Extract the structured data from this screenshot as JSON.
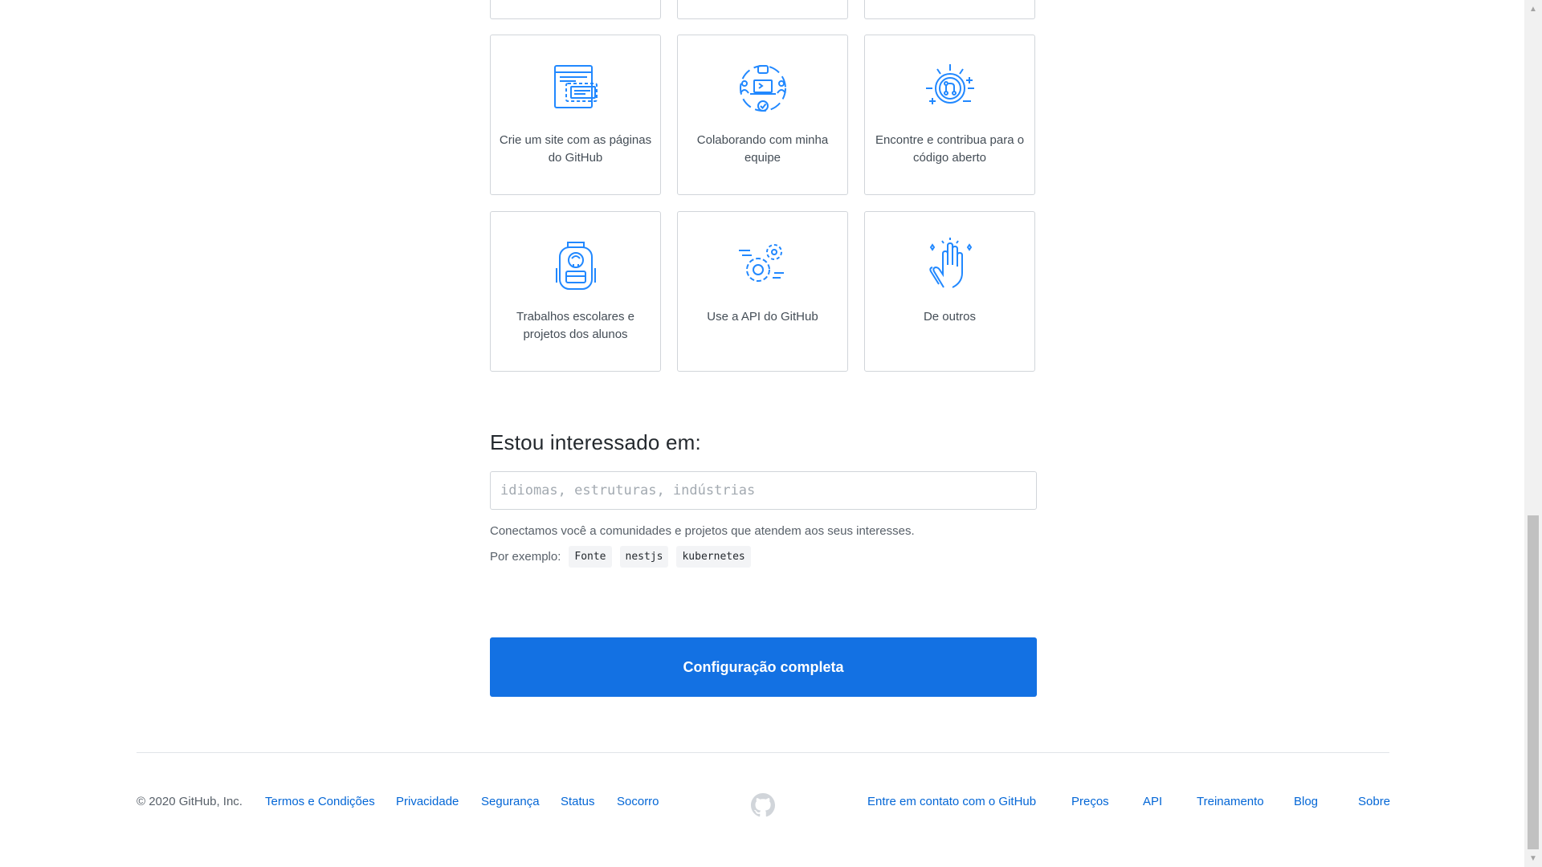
{
  "cards": {
    "row2": [
      {
        "label": "Crie um site com as páginas do GitHub",
        "icon": "web-pages-icon"
      },
      {
        "label": "Colaborando com minha equipe",
        "icon": "team-collab-icon"
      },
      {
        "label": "Encontre e contribua para o código aberto",
        "icon": "open-source-icon"
      }
    ],
    "row3": [
      {
        "label": "Trabalhos escolares e projetos dos alunos",
        "icon": "backpack-icon"
      },
      {
        "label": "Use a API do GitHub",
        "icon": "gear-api-icon"
      },
      {
        "label": "De outros",
        "icon": "high-five-icon"
      }
    ]
  },
  "interest": {
    "heading": "Estou interessado em:",
    "placeholder": "idiomas, estruturas, indústrias",
    "help": "Conectamos você a comunidades e projetos que atendem aos seus interesses.",
    "examples_label": "Por exemplo:",
    "examples": [
      "Fonte",
      "nestjs",
      "kubernetes"
    ]
  },
  "complete_button": "Configuração completa",
  "footer": {
    "copyright": "© 2020 GitHub, Inc.",
    "left_links": [
      "Termos e Condições",
      "Privacidade",
      "Segurança",
      "Status",
      "Socorro"
    ],
    "right_links": [
      "Entre em contato com o GitHub",
      "Preços",
      "API",
      "Treinamento",
      "Blog",
      "Sobre"
    ]
  },
  "colors": {
    "accent": "#1371e3",
    "link": "#0366d6",
    "icon": "#2188ff"
  }
}
